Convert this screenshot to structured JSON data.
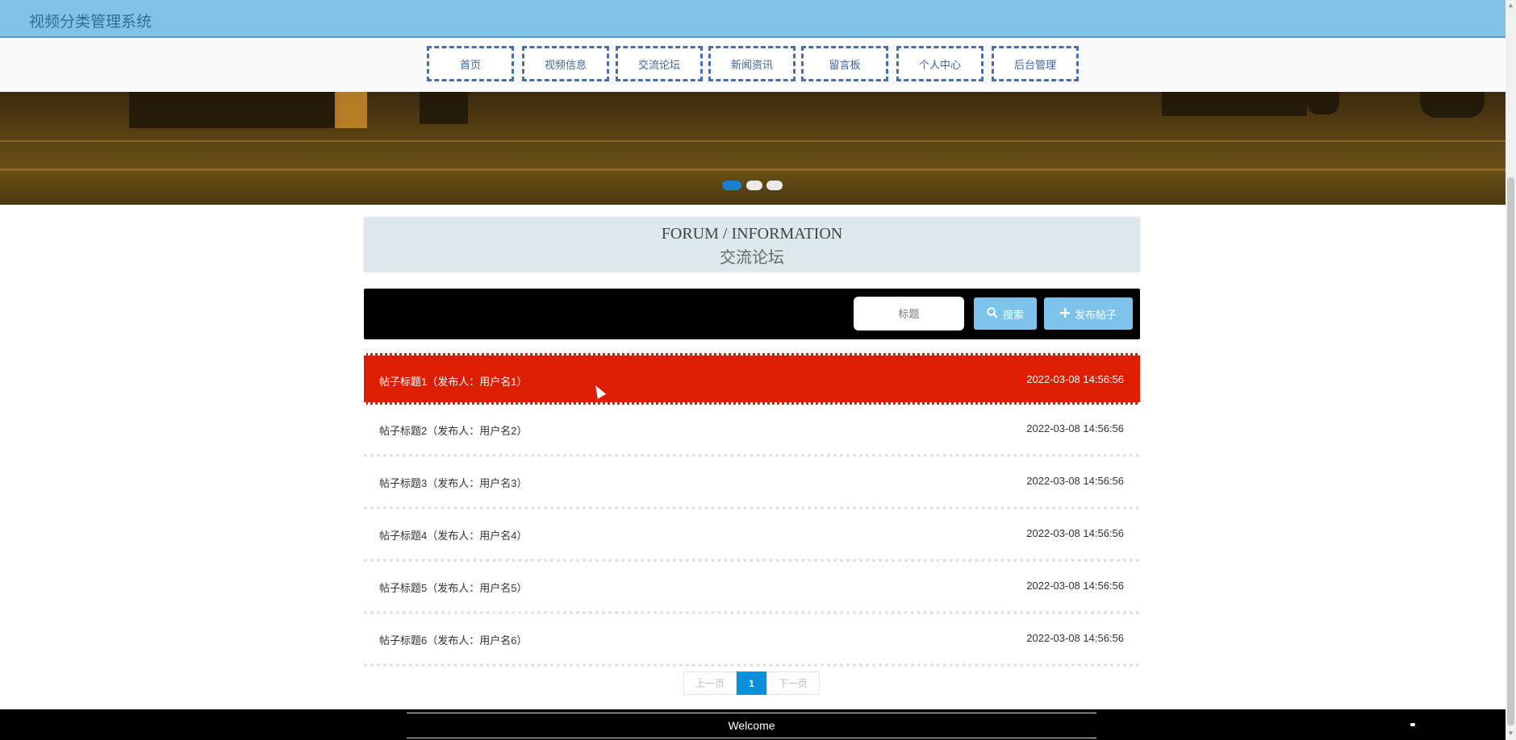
{
  "app": {
    "title": "视频分类管理系统"
  },
  "nav": {
    "items": [
      {
        "label": "首页"
      },
      {
        "label": "视频信息"
      },
      {
        "label": "交流论坛"
      },
      {
        "label": "新闻资讯"
      },
      {
        "label": "留言板"
      },
      {
        "label": "个人中心"
      },
      {
        "label": "后台管理"
      }
    ]
  },
  "carousel": {
    "dots": 3,
    "active_index": 0,
    "accent_color": "#1a7fd0"
  },
  "section": {
    "title_en": "FORUM / INFORMATION",
    "title_cn": "交流论坛"
  },
  "search": {
    "placeholder": "标题",
    "search_label": "搜索",
    "search_icon": "search-icon",
    "publish_label": "发布帖子",
    "publish_icon": "plus-icon",
    "button_color": "#7ec3ea"
  },
  "posts": [
    {
      "title": "帖子标题1（发布人：用户名1）",
      "time": "2022-03-08 14:56:56",
      "active": true
    },
    {
      "title": "帖子标题2（发布人：用户名2）",
      "time": "2022-03-08 14:56:56",
      "active": false
    },
    {
      "title": "帖子标题3（发布人：用户名3）",
      "time": "2022-03-08 14:56:56",
      "active": false
    },
    {
      "title": "帖子标题4（发布人：用户名4）",
      "time": "2022-03-08 14:56:56",
      "active": false
    },
    {
      "title": "帖子标题5（发布人：用户名5）",
      "time": "2022-03-08 14:56:56",
      "active": false
    },
    {
      "title": "帖子标题6（发布人：用户名6）",
      "time": "2022-03-08 14:56:56",
      "active": false
    }
  ],
  "pagination": {
    "prev_label": "上一页",
    "current_page": "1",
    "next_label": "下一页"
  },
  "footer": {
    "text": "Welcome"
  },
  "colors": {
    "header_bg": "#81c2e6",
    "active_row": "#dd1e02",
    "page_active": "#0a8fd8"
  }
}
